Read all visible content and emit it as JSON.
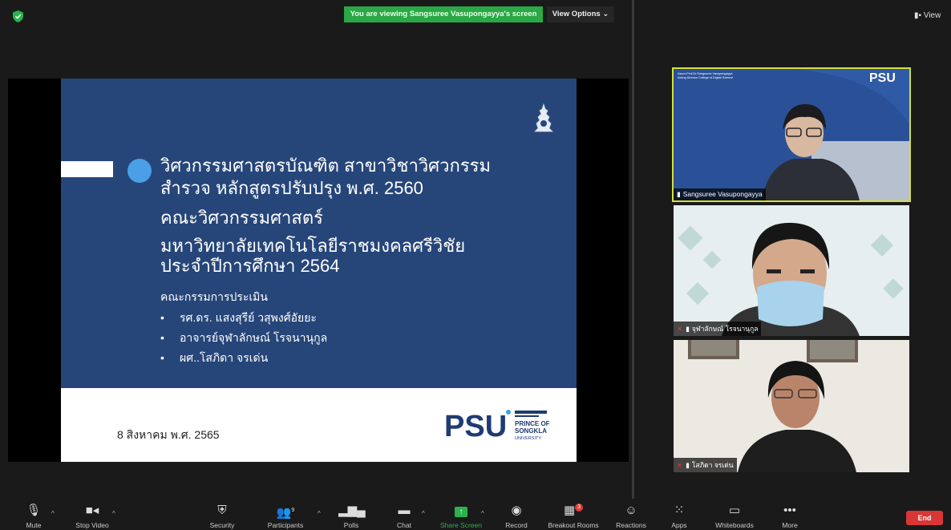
{
  "top_bar": {
    "banner_text": "You are viewing Sangsuree Vasupongayya's screen",
    "view_options_label": "View Options ⌄",
    "view_label": "View"
  },
  "slide": {
    "title_line1": "วิศวกรรมศาสตรบัณฑิต สาขาวิชาวิศวกรรม",
    "title_line2": "สำรวจ  หลักสูตรปรับปรุง พ.ศ. 2560",
    "faculty": "คณะวิศวกรรมศาสตร์",
    "university_line1": "มหาวิทยาลัยเทคโนโลยีราชมงคลศรีวิชัย",
    "university_line2": "ประจำปีการศึกษา 2564",
    "committee_heading": "คณะกรรมการประเมิน",
    "committee_members": [
      "รศ.ดร. แสงสุรีย์ วสุพงศ์อัยยะ",
      "อาจารย์จุฬาลักษณ์ โรจนานุกูล",
      "ผศ..โสภิดา จรเด่น"
    ],
    "date": "8 สิงหาคม พ.ศ. 2565",
    "logo_text": "PRINCE OF SONGKLA UNIVERSITY",
    "logo_letters": "PSU"
  },
  "participants_tiles": [
    {
      "name": "Sangsuree Vasupongayya",
      "vbg_line1": "Assoc.Prof.Dr.Sangsuree Vasupongayya",
      "vbg_line2": "Acting Director College of Digital Science",
      "muted": false,
      "active_speaker": true
    },
    {
      "name": "จุฬาลักษณ์ โรจนานุกูล",
      "muted": true,
      "active_speaker": false
    },
    {
      "name": "โสภิดา จรเด่น",
      "muted": true,
      "active_speaker": false
    }
  ],
  "toolbar": {
    "mute": "Mute",
    "stop_video": "Stop Video",
    "security": "Security",
    "participants": "Participants",
    "participants_count": "9",
    "polls": "Polls",
    "chat": "Chat",
    "share_screen": "Share Screen",
    "record": "Record",
    "breakout_rooms": "Breakout Rooms",
    "breakout_badge": "3",
    "reactions": "Reactions",
    "apps": "Apps",
    "whiteboards": "Whiteboards",
    "more": "More",
    "end": "End"
  },
  "colors": {
    "banner_green": "#2aa845",
    "slide_blue": "#26467a",
    "active_speaker_border": "#d5df3a",
    "end_red": "#d93636",
    "share_screen_green": "#2ab24f"
  }
}
